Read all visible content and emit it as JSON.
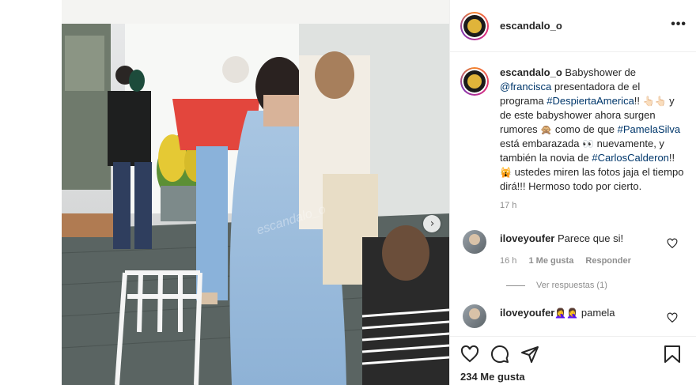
{
  "post": {
    "username": "escandalo_o",
    "more_label": "•••",
    "watermark": "escandalo_o",
    "next_label": "›"
  },
  "caption": {
    "username": "escandalo_o",
    "t1": " Babyshower de ",
    "tag1": "@francisca",
    "t2": " presentadora de el programa ",
    "tag2": "#DespiertaAmerica",
    "t3": "!! ",
    "e1": "👆🏻👆🏻",
    "t4": " y de este babyshower ahora surgen rumores ",
    "e2": "🙊",
    "t5": " como de que ",
    "tag3": "#PamelaSilva",
    "t6": " está embarazada ",
    "e3": "👀",
    "t7": " nuevamente, y también la novia de ",
    "tag4": "#CarlosCalderon",
    "t8": "!! ",
    "e4": "🙀",
    "t9": " ustedes miren las fotos jaja el tiempo dirá!!! Hermoso todo por cierto.",
    "time": "17 h"
  },
  "comments": [
    {
      "username": "iloveyoufer",
      "text": " Parece que si!",
      "time": "16 h",
      "likes": "1 Me gusta",
      "reply": "Responder",
      "view_replies": "Ver respuestas (1)"
    },
    {
      "username": "iloveyoufer",
      "emoji": " 🤦‍♀️🤦‍♀️",
      "text": " pamela"
    }
  ],
  "footer": {
    "likes": "234 Me gusta"
  },
  "icons": [
    "more-icon",
    "heart-icon",
    "comment-icon",
    "share-icon",
    "save-icon",
    "chevron-right-icon"
  ],
  "colors": {
    "hashtag": "#00376b",
    "muted": "#8e8e8e",
    "text": "#262626",
    "border": "#efefef"
  }
}
